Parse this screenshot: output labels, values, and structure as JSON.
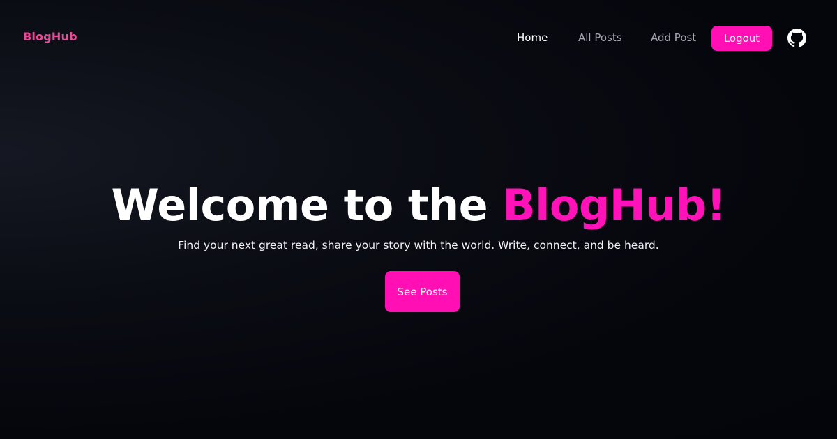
{
  "nav": {
    "brand": "BlogHub",
    "links": [
      {
        "label": "Home",
        "active": true
      },
      {
        "label": "All Posts",
        "active": false
      },
      {
        "label": "Add Post",
        "active": false
      }
    ],
    "logout_label": "Logout",
    "github_icon": "github-icon"
  },
  "hero": {
    "title_prefix": "Welcome to the ",
    "title_accent": "BlogHub!",
    "subtitle": "Find your next great read, share your story with the world. Write, connect, and be heard.",
    "cta_label": "See Posts"
  },
  "colors": {
    "accent": "#ff0fb4",
    "brand": "#f0499b",
    "background": "#05060c",
    "nav_inactive": "#a8a8b3"
  }
}
